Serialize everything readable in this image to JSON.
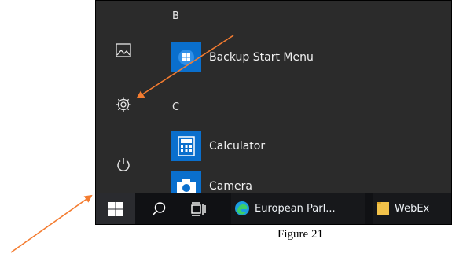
{
  "start_menu": {
    "rail": [
      {
        "icon": "image-icon"
      },
      {
        "icon": "gear-icon"
      },
      {
        "icon": "power-icon"
      }
    ],
    "groups": [
      {
        "letter": "B",
        "apps": [
          {
            "label": "Backup Start Menu",
            "icon": "windows-logo-icon"
          }
        ]
      },
      {
        "letter": "C",
        "apps": [
          {
            "label": "Calculator",
            "icon": "calculator-icon"
          },
          {
            "label": "Camera",
            "icon": "camera-icon"
          }
        ]
      }
    ]
  },
  "taskbar": {
    "items": [
      {
        "icon": "windows-logo-icon"
      },
      {
        "icon": "search-icon"
      },
      {
        "icon": "task-view-icon"
      },
      {
        "label": "European Parl...",
        "icon": "edge-icon"
      },
      {
        "label": "WebEx",
        "icon": "folder-icon"
      }
    ]
  },
  "caption": "Figure 21",
  "colors": {
    "arrow": "#f47c30",
    "tile": "#0a6fcd",
    "menu_bg": "#2b2b2b",
    "taskbar_bg": "#101114"
  }
}
